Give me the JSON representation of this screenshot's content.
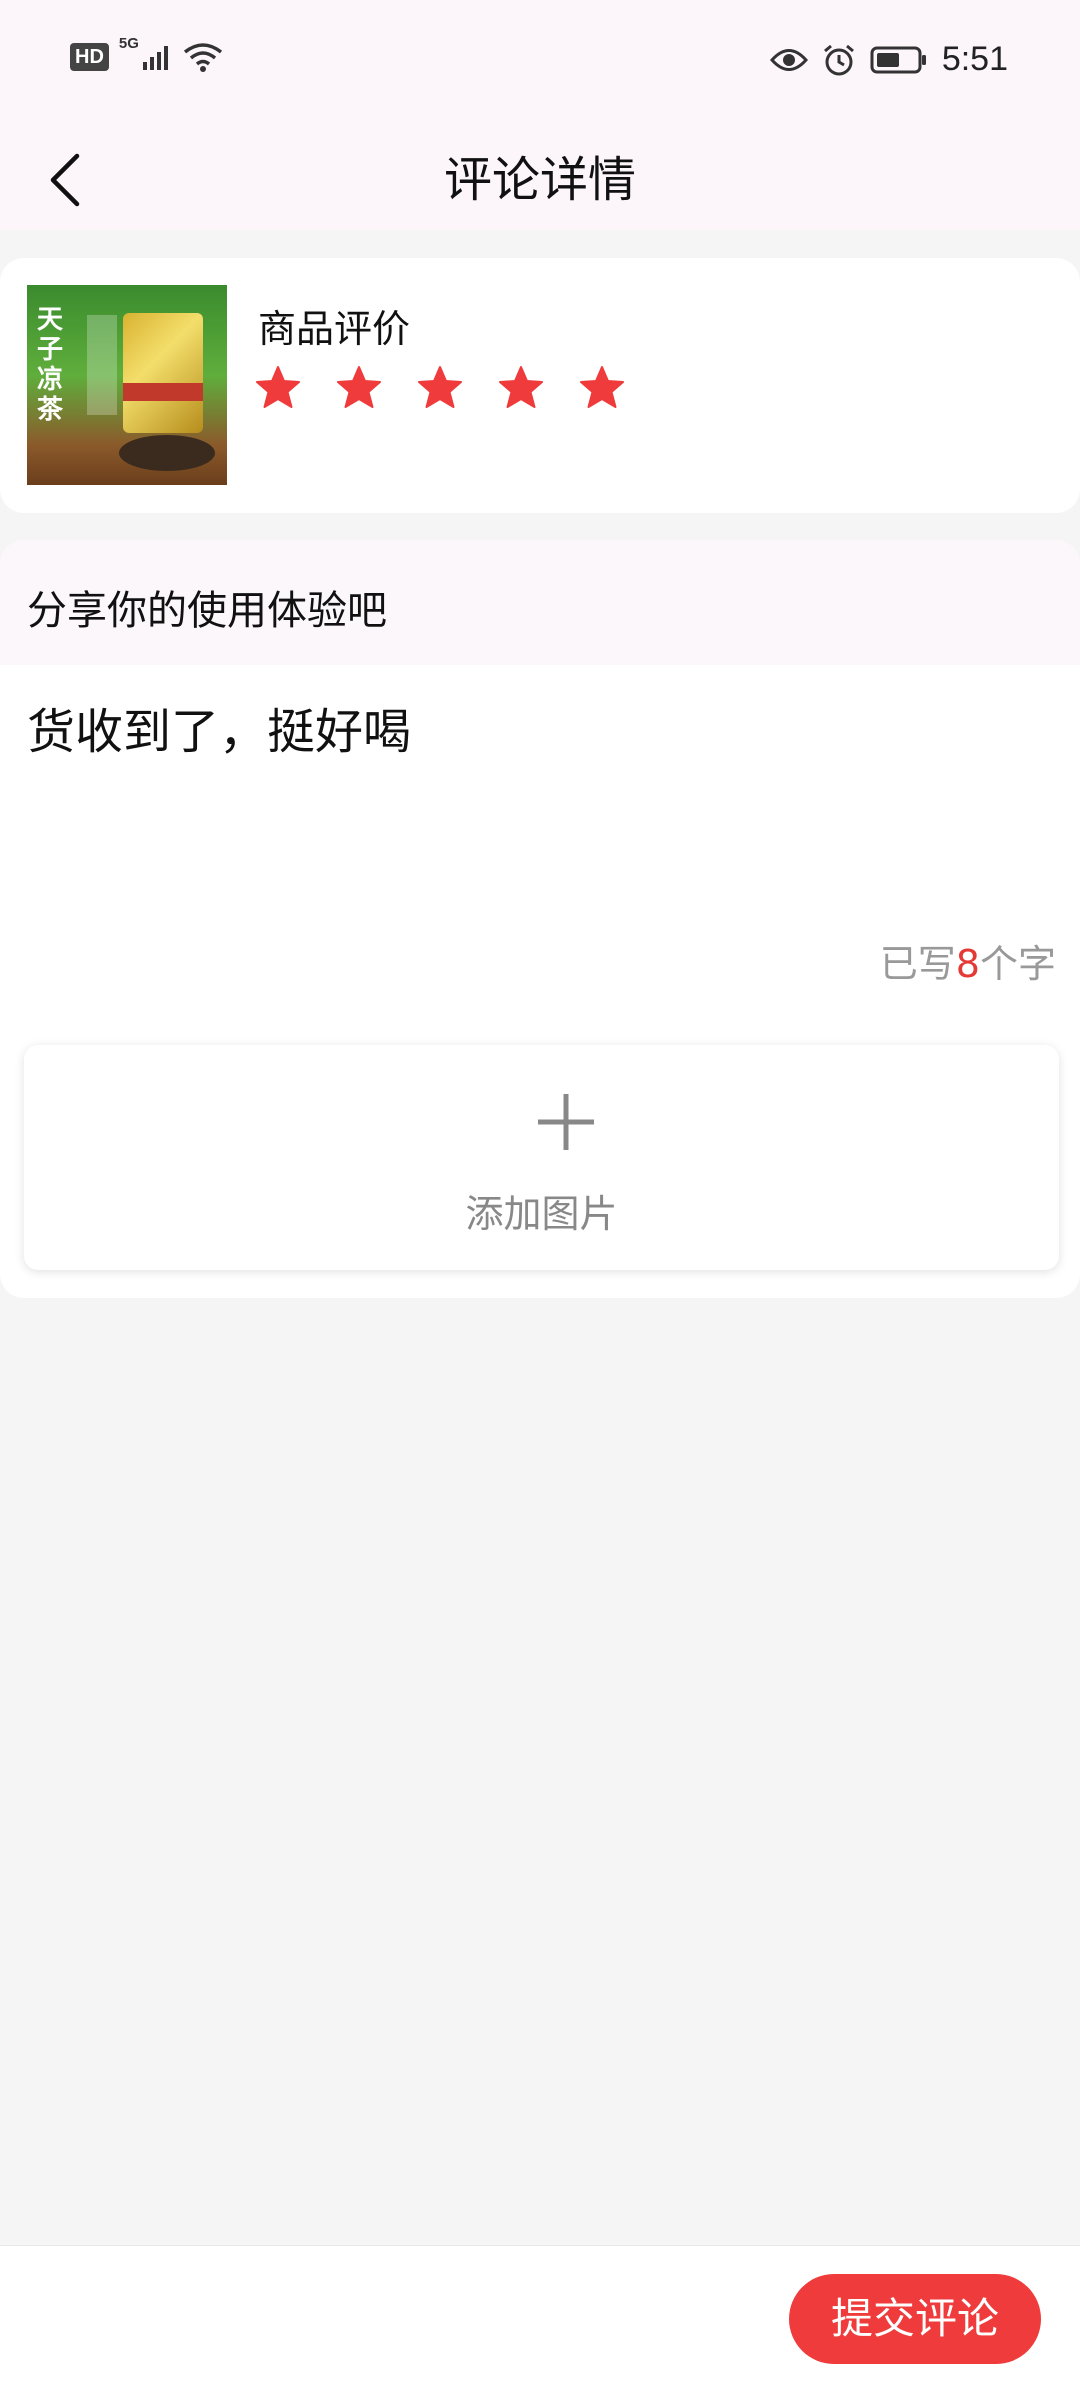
{
  "status_bar": {
    "hd_label": "HD",
    "network_label": "5G",
    "time": "5:51",
    "icons": [
      "signal-icon",
      "wifi-icon",
      "eye-icon",
      "alarm-icon",
      "battery-icon"
    ]
  },
  "nav": {
    "title": "评论详情",
    "back_icon": "chevron-left-icon"
  },
  "product": {
    "thumb_text": "天子凉茶",
    "rating_label": "商品评价",
    "rating": 5,
    "rating_max": 5
  },
  "review": {
    "prompt": "分享你的使用体验吧",
    "text": "货收到了，挺好喝",
    "count_prefix": "已写",
    "count_value": "8",
    "count_suffix": "个字",
    "add_photo_label": "添加图片"
  },
  "bottom": {
    "submit_label": "提交评论"
  },
  "colors": {
    "accent": "#ef3b3b",
    "star": "#ef3b3b",
    "header_bg": "#fcf6fa",
    "page_bg": "#f5f5f5",
    "muted_text": "#999999"
  }
}
